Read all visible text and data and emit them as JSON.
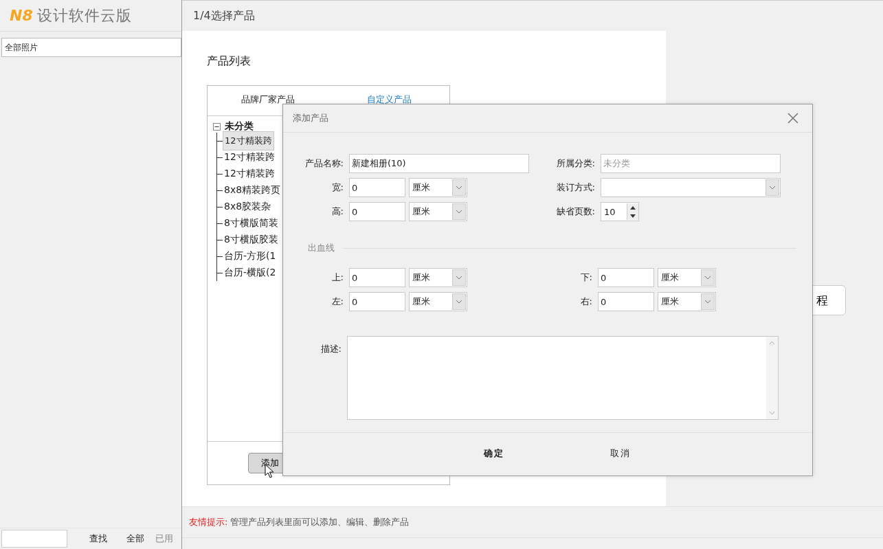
{
  "app": {
    "logo": "N8",
    "title": "设计软件云版",
    "album_select": "全部照片",
    "find_button": "查找",
    "all_button": "全部",
    "used_label": "已用"
  },
  "wizard": {
    "title": "1/4选择产品",
    "heading": "产品列表",
    "tabs": [
      {
        "label": "品牌厂家产品",
        "selected": true
      },
      {
        "label": "自定义产品",
        "selected": false
      }
    ],
    "tree": {
      "label": "未分类",
      "expanded": true,
      "children": [
        {
          "label": "12寸精装跨",
          "selected": true
        },
        {
          "label": "12寸精装跨",
          "selected": false
        },
        {
          "label": "12寸精装跨",
          "selected": false
        },
        {
          "label": "8x8精装跨页",
          "selected": false
        },
        {
          "label": "8x8胶装杂",
          "selected": false
        },
        {
          "label": "8寸横版简装",
          "selected": false
        },
        {
          "label": "8寸横版胶装",
          "selected": false
        },
        {
          "label": "台历-方形(1",
          "selected": false
        },
        {
          "label": "台历-横版(2",
          "selected": false
        }
      ]
    },
    "add_button": "添加",
    "side_button": "程",
    "hint_label": "友情提示:",
    "hint_text": "管理产品列表里面可以添加、编辑、删除产品"
  },
  "dialog": {
    "title": "添加产品",
    "fields": [
      {
        "kind": "text",
        "label": "产品名称:",
        "value": "新建相册(10)",
        "disabled": false
      },
      {
        "kind": "text",
        "label": "所属分类:",
        "value": "未分类",
        "disabled": true
      },
      {
        "kind": "size",
        "label": "宽:",
        "value": "0",
        "unit": "厘米"
      },
      {
        "kind": "select",
        "label": "装订方式:"
      },
      {
        "kind": "size",
        "label": "高:",
        "value": "0",
        "unit": "厘米"
      },
      {
        "kind": "spinner",
        "label": "缺省页数:",
        "value": "10"
      }
    ],
    "bleed_legend": "出血线",
    "bleed_fields": [
      {
        "label": "上:",
        "value": "0",
        "unit": "厘米"
      },
      {
        "label": "下:",
        "value": "0",
        "unit": "厘米"
      },
      {
        "label": "左:",
        "value": "0",
        "unit": "厘米"
      },
      {
        "label": "右:",
        "value": "0",
        "unit": "厘米"
      }
    ],
    "description_label": "描述:",
    "buttons": [
      {
        "label": "确定",
        "kind": "primary"
      },
      {
        "label": "取消",
        "kind": "secondary"
      }
    ]
  }
}
